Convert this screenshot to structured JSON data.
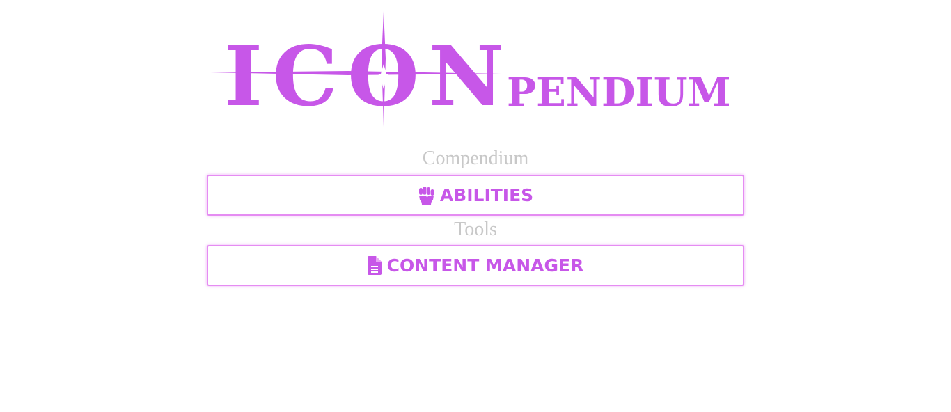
{
  "logo": {
    "main_text": "ICON",
    "suffix_text": "PENDIUM"
  },
  "colors": {
    "accent": "#c757e8",
    "border": "#e58cf2",
    "divider_text": "#c8c8c8",
    "divider_rule": "#cccccc"
  },
  "sections": [
    {
      "heading": "Compendium",
      "buttons": [
        {
          "label": "ABILITIES",
          "icon": "fist-icon"
        }
      ]
    },
    {
      "heading": "Tools",
      "buttons": [
        {
          "label": "CONTENT MANAGER",
          "icon": "file-icon"
        }
      ]
    }
  ]
}
